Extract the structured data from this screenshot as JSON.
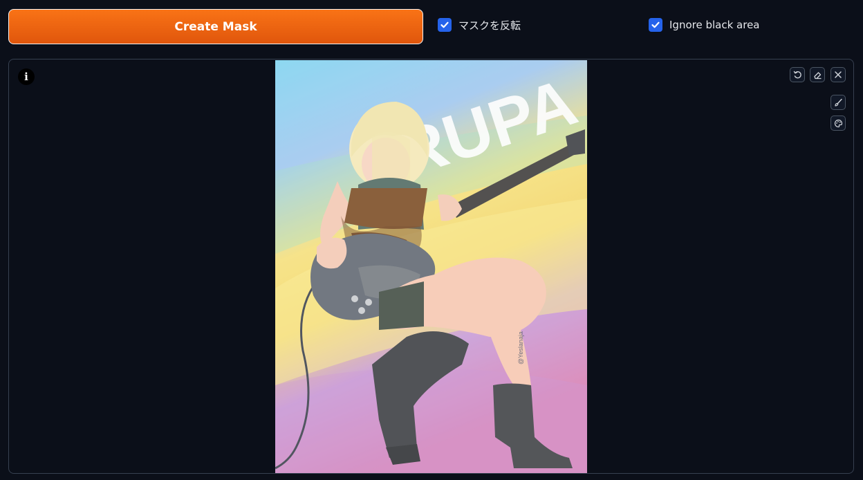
{
  "toolbar": {
    "create_mask_label": "Create Mask",
    "invert_mask_label": "マスクを反転",
    "invert_mask_checked": true,
    "ignore_black_label": "Ignore black area",
    "ignore_black_checked": true
  },
  "canvas": {
    "info_icon": "info-icon",
    "info_glyph": "i",
    "tools": [
      "undo-icon",
      "eraser-icon",
      "close-icon",
      "brush-icon",
      "palette-icon"
    ],
    "artwork_text": "RUPA",
    "artwork_signature": "@Yeslanaja"
  },
  "colors": {
    "accent": "#f97316",
    "checkbox": "#2563eb",
    "background": "#0b0f19"
  }
}
